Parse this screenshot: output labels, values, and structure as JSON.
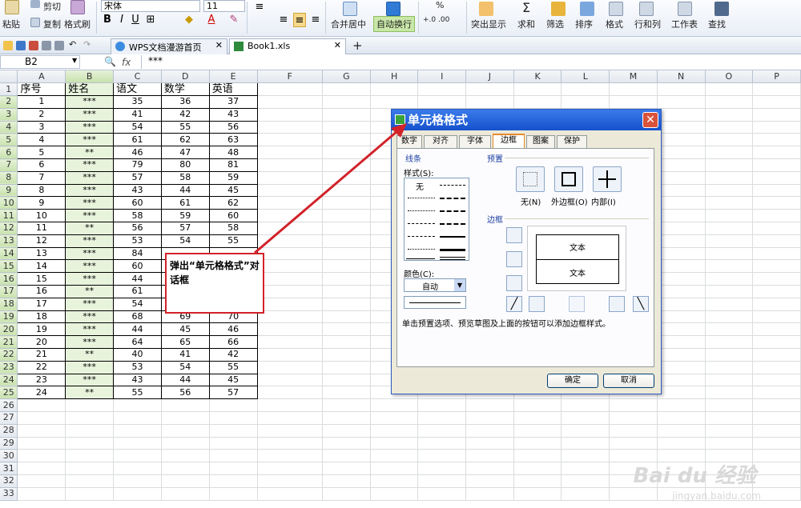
{
  "ribbon": {
    "cut_label": "剪切",
    "paste_label": "粘贴",
    "copy_label": "复制",
    "format_painter_label": "格式刷",
    "font_name": "宋体",
    "font_size": "11",
    "merge_label": "合并居中",
    "wrap_label": "自动换行",
    "percent_label": "%",
    "highlight_label": "突出显示",
    "sum_label": "求和",
    "filter_label": "筛选",
    "sort_label": "排序",
    "format_label": "格式",
    "rowcol_label": "行和列",
    "sheet_label": "工作表",
    "find_label": "查找"
  },
  "tabs": [
    {
      "label": "WPS文档漫游首页"
    },
    {
      "label": "Book1.xls"
    }
  ],
  "formula_bar": {
    "cell_ref": "B2",
    "fx": "fx",
    "content": "***"
  },
  "sheet": {
    "columns": [
      "A",
      "B",
      "C",
      "D",
      "E",
      "F",
      "G",
      "H",
      "I",
      "J",
      "K",
      "L",
      "M",
      "N",
      "O",
      "P"
    ],
    "header_row": [
      "序号",
      "姓名",
      "语文",
      "数学",
      "英语"
    ],
    "rows": [
      [
        "1",
        "***",
        "35",
        "36",
        "37"
      ],
      [
        "2",
        "***",
        "41",
        "42",
        "43"
      ],
      [
        "3",
        "***",
        "54",
        "55",
        "56"
      ],
      [
        "4",
        "***",
        "61",
        "62",
        "63"
      ],
      [
        "5",
        "**",
        "46",
        "47",
        "48"
      ],
      [
        "6",
        "***",
        "79",
        "80",
        "81"
      ],
      [
        "7",
        "***",
        "57",
        "58",
        "59"
      ],
      [
        "8",
        "***",
        "43",
        "44",
        "45"
      ],
      [
        "9",
        "***",
        "60",
        "61",
        "62"
      ],
      [
        "10",
        "***",
        "58",
        "59",
        "60"
      ],
      [
        "11",
        "**",
        "56",
        "57",
        "58"
      ],
      [
        "12",
        "***",
        "53",
        "54",
        "55"
      ],
      [
        "13",
        "***",
        "84",
        "",
        ""
      ],
      [
        "14",
        "***",
        "60",
        "",
        ""
      ],
      [
        "15",
        "***",
        "44",
        "",
        ""
      ],
      [
        "16",
        "**",
        "61",
        "",
        ""
      ],
      [
        "17",
        "***",
        "54",
        "",
        ""
      ],
      [
        "18",
        "***",
        "68",
        "69",
        "70"
      ],
      [
        "19",
        "***",
        "44",
        "45",
        "46"
      ],
      [
        "20",
        "***",
        "64",
        "65",
        "66"
      ],
      [
        "21",
        "**",
        "40",
        "41",
        "42"
      ],
      [
        "22",
        "***",
        "53",
        "54",
        "55"
      ],
      [
        "23",
        "***",
        "43",
        "44",
        "45"
      ],
      [
        "24",
        "**",
        "55",
        "56",
        "57"
      ]
    ],
    "row_numbers": [
      "1",
      "2",
      "3",
      "4",
      "5",
      "6",
      "7",
      "8",
      "9",
      "10",
      "11",
      "12",
      "13",
      "14",
      "15",
      "16",
      "17",
      "18",
      "19",
      "20",
      "21",
      "22",
      "23",
      "24",
      "25",
      "26",
      "27",
      "28",
      "29",
      "30",
      "31",
      "32",
      "33"
    ]
  },
  "dialog": {
    "title": "单元格格式",
    "tabs": [
      "数字",
      "对齐",
      "字体",
      "边框",
      "图案",
      "保护"
    ],
    "active_tab": "边框",
    "line_group": "线条",
    "style_label": "样式(S):",
    "none_style": "无",
    "color_label": "颜色(C):",
    "color_value": "自动",
    "preset_group": "预置",
    "preset_none": "无(N)",
    "preset_outline": "外边框(O)",
    "preset_inside": "内部(I)",
    "border_group": "边框",
    "preview_text_1": "文本",
    "preview_text_2": "文本",
    "hint": "单击预置选项、预览草图及上面的按钮可以添加边框样式。",
    "ok_label": "确定",
    "cancel_label": "取消"
  },
  "annotation": {
    "text": "弹出“单元格格式”对话框"
  },
  "watermark": {
    "logo": "Bai du 经验",
    "url": "jingyan.baidu.com"
  },
  "colors": {
    "accent_red": "#d2232a",
    "title_blue": "#1551cc",
    "selection_green": "#e8f3dc"
  }
}
